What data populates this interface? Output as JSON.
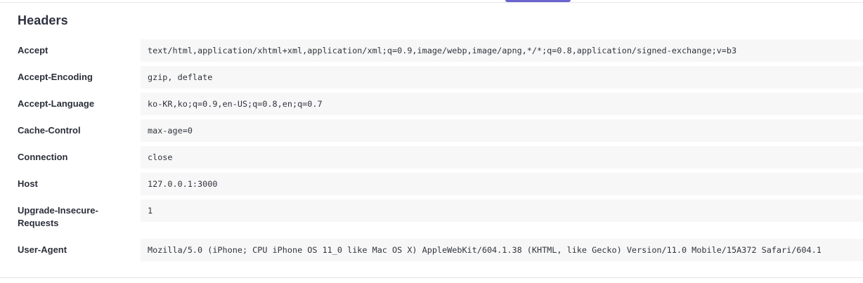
{
  "page": {
    "section_title": "Headers"
  },
  "headers": [
    {
      "name": "Accept",
      "value": "text/html,application/xhtml+xml,application/xml;q=0.9,image/webp,image/apng,*/*;q=0.8,application/signed-exchange;v=b3"
    },
    {
      "name": "Accept-Encoding",
      "value": "gzip, deflate"
    },
    {
      "name": "Accept-Language",
      "value": "ko-KR,ko;q=0.9,en-US;q=0.8,en;q=0.7"
    },
    {
      "name": "Cache-Control",
      "value": "max-age=0"
    },
    {
      "name": "Connection",
      "value": "close"
    },
    {
      "name": "Host",
      "value": "127.0.0.1:3000"
    },
    {
      "name": "Upgrade-Insecure-Requests",
      "name_line_1": "Upgrade-Insecure-",
      "name_line_2": "Requests",
      "value": "1"
    },
    {
      "name": "User-Agent",
      "value": "Mozilla/5.0 (iPhone; CPU iPhone OS 11_0 like Mac OS X) AppleWebKit/604.1.38 (KHTML, like Gecko) Version/11.0 Mobile/15A372 Safari/604.1"
    }
  ],
  "colors": {
    "accent": "#6b63cf",
    "value_background": "#f7f7f7",
    "divider": "#e6e7ea"
  }
}
